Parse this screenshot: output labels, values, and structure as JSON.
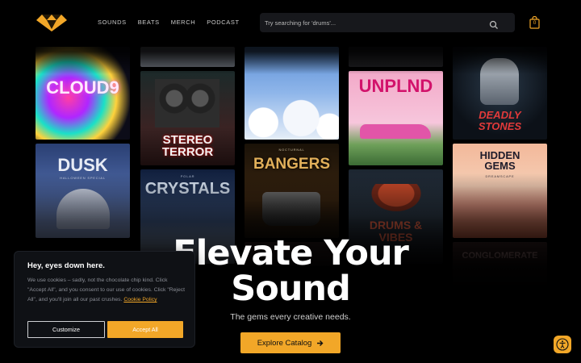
{
  "header": {
    "logo_icon": "diamond-logo-icon",
    "nav": [
      "SOUNDS",
      "BEATS",
      "MERCH",
      "PODCAST"
    ],
    "search_placeholder": "Try searching for 'drums'...",
    "search_icon": "search-icon",
    "cart_icon": "shopping-bag-icon",
    "cart_count": "0"
  },
  "tiles": [
    {
      "label": "CLOUD9",
      "sub": ""
    },
    {
      "label": "STEREO TERROR",
      "sub": ""
    },
    {
      "label": "DUSK",
      "sub": "HALLOWEEN SPECIAL"
    },
    {
      "label": "CRYSTALS",
      "sub": "POLAR"
    },
    {
      "label": "",
      "sub": ""
    },
    {
      "label": "BANGERS",
      "sub": "NOCTURNAL"
    },
    {
      "label": "UNPLND",
      "sub": ""
    },
    {
      "label": "DRUMS & VIBES",
      "sub": ""
    },
    {
      "label": "DEADLY STONES",
      "sub": ""
    },
    {
      "label": "HIDDEN GEMS",
      "sub": "DREAMSCAPE"
    },
    {
      "label": "CONGLOMERATE",
      "sub": ""
    }
  ],
  "hero": {
    "title_line1": "Elevate Your",
    "title_line2": "Sound",
    "subtitle": "The gems every creative needs.",
    "cta_label": "Explore Catalog",
    "cta_icon": "arrow-right-icon"
  },
  "cookie": {
    "title": "Hey, eyes down here.",
    "body": "We use cookies – sadly, not the chocolate chip kind. Click \"Accept All\", and you consent to our use of cookies. Click \"Reject All\", and you'll join all our past crushes.",
    "policy_link": "Cookie Policy",
    "customize_label": "Customize",
    "accept_label": "Accept All"
  },
  "accessibility_icon": "accessibility-icon",
  "colors": {
    "accent": "#f2a728",
    "background": "#000000"
  }
}
